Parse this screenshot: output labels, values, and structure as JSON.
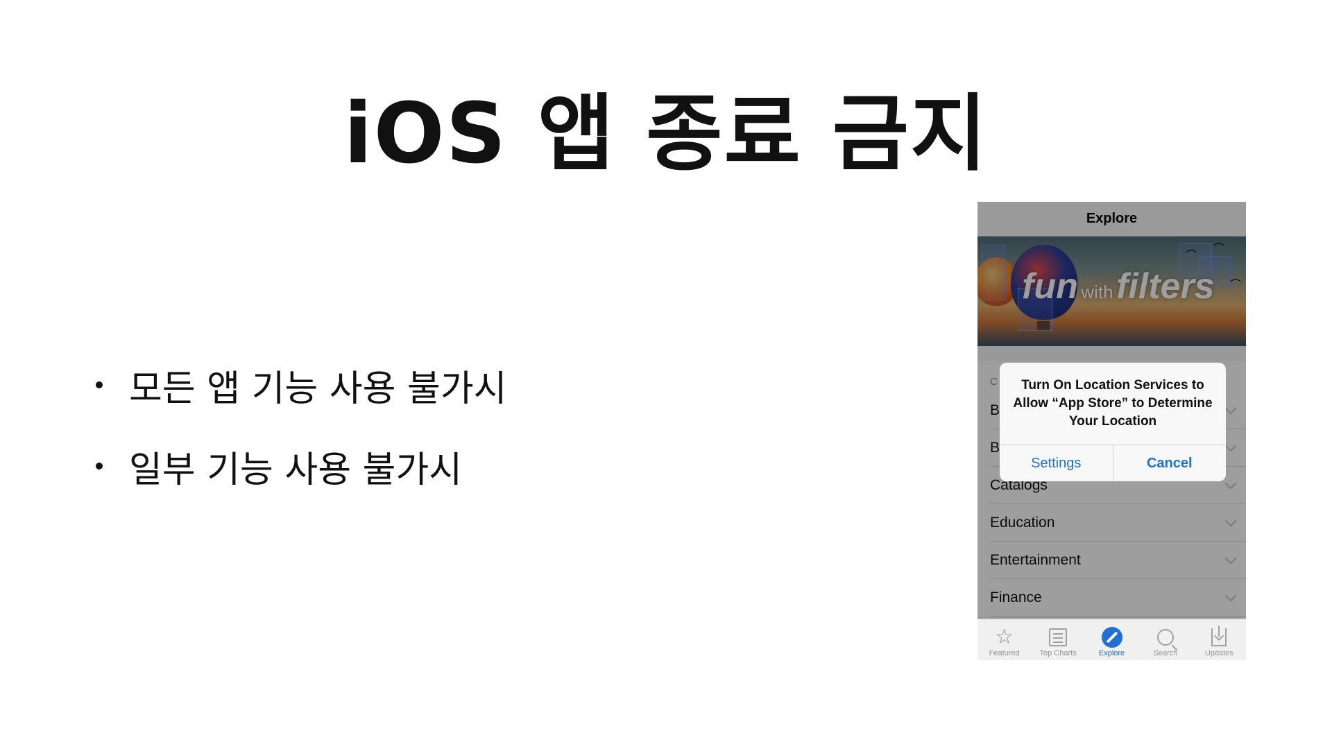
{
  "slide": {
    "title": "iOS 앱 종료 금지",
    "bullets": [
      {
        "text": "모든 앱 기능 사용 불가시"
      },
      {
        "text": "일부 기능 사용 불가시"
      }
    ]
  },
  "phone": {
    "nav_title": "Explore",
    "banner": {
      "big_text_1": "fun",
      "small_text": "with",
      "big_text_2": "filters"
    },
    "list": {
      "header": "C",
      "rows": [
        {
          "label": "B"
        },
        {
          "label": "B"
        },
        {
          "label": "Catalogs"
        },
        {
          "label": "Education"
        },
        {
          "label": "Entertainment"
        },
        {
          "label": "Finance"
        }
      ]
    },
    "alert": {
      "message": "Turn On Location Services to Allow “App Store” to Determine Your Location",
      "settings_label": "Settings",
      "cancel_label": "Cancel"
    },
    "tabs": [
      {
        "label": "Featured",
        "icon": "star-icon"
      },
      {
        "label": "Top Charts",
        "icon": "list-icon"
      },
      {
        "label": "Explore",
        "icon": "compass-icon",
        "active": true
      },
      {
        "label": "Search",
        "icon": "search-icon"
      },
      {
        "label": "Updates",
        "icon": "updates-icon"
      }
    ],
    "colors": {
      "accent": "#1f6fd4",
      "inactive": "#929292"
    }
  }
}
